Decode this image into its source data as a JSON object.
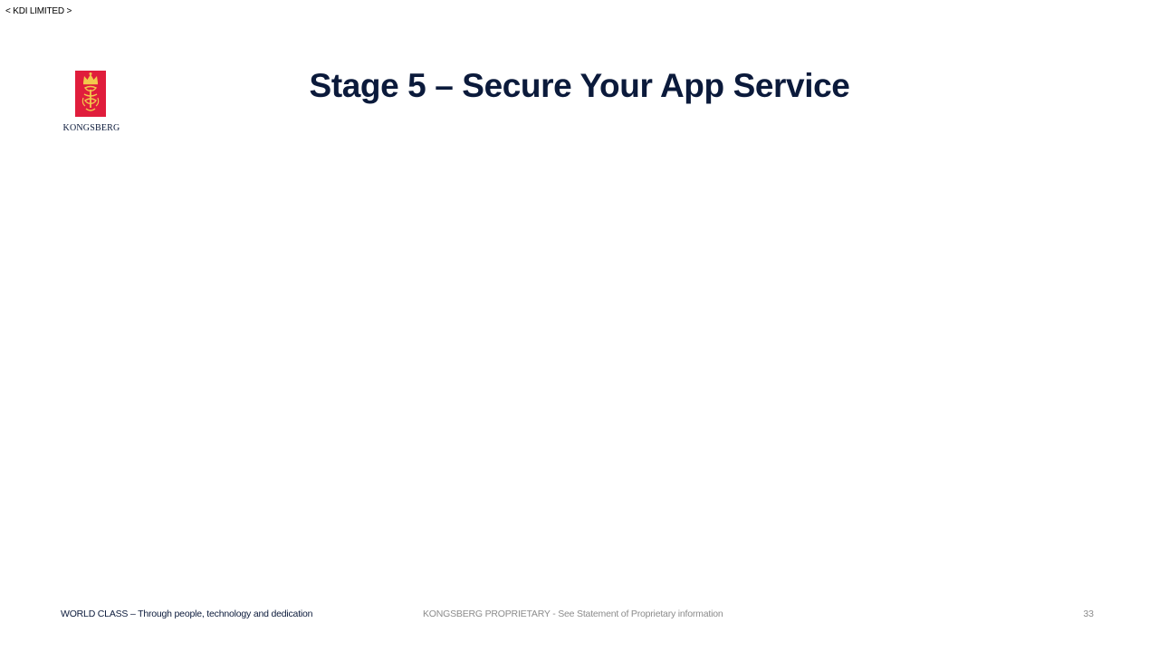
{
  "header": {
    "classification": "< KDI LIMITED >"
  },
  "logo": {
    "wordmark": "KONGSBERG",
    "icon": "kongsberg-crest-icon",
    "crest_color": "#e01d3c",
    "emblem_color": "#f2c94c"
  },
  "slide": {
    "title": "Stage 5 – Secure Your App Service"
  },
  "footer": {
    "tagline": "WORLD CLASS  –  Through people, technology and dedication",
    "proprietary": "KONGSBERG PROPRIETARY  - See Statement of Proprietary information",
    "page_number": "33"
  },
  "colors": {
    "title": "#0b1a3b",
    "footer_muted": "#8c8c8c"
  }
}
